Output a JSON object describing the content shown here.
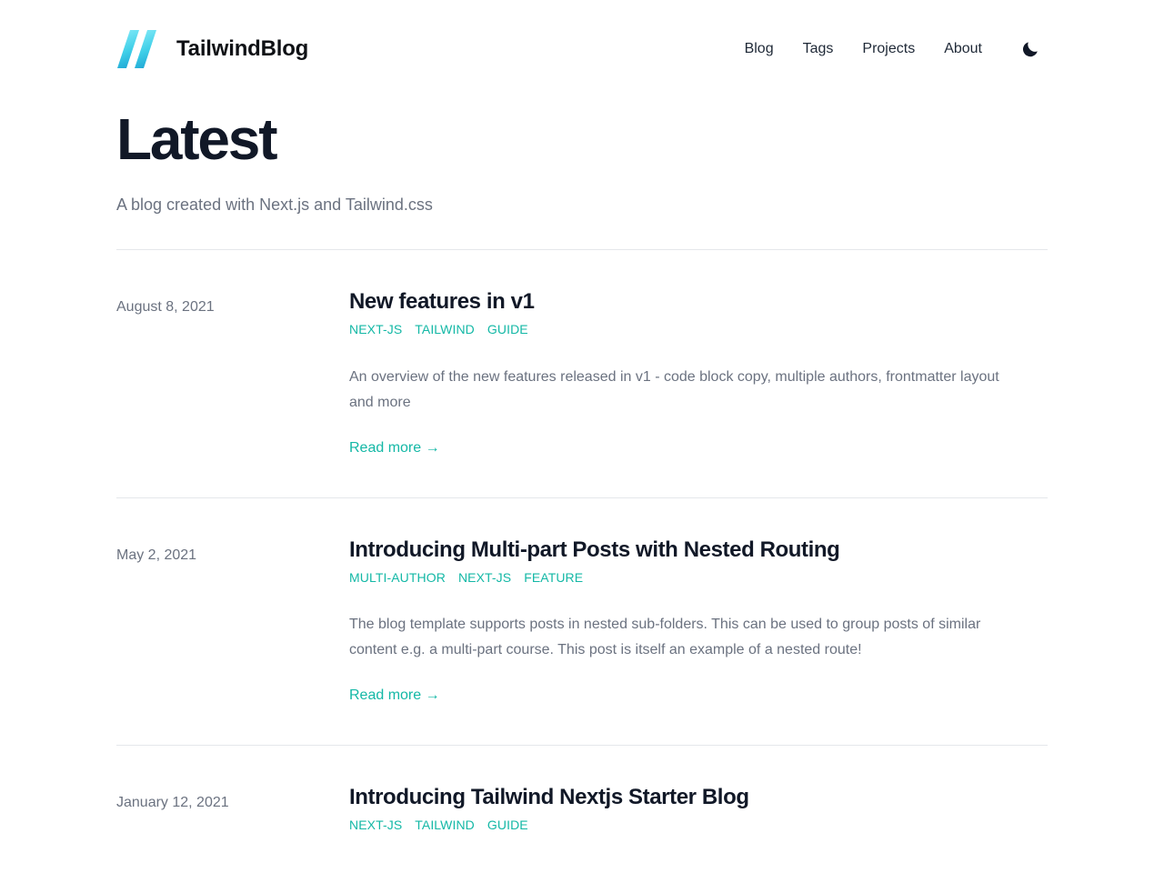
{
  "header": {
    "brand_name": "TailwindBlog",
    "logo_icon": "tailwind-slashes-logo",
    "nav": [
      {
        "label": "Blog"
      },
      {
        "label": "Tags"
      },
      {
        "label": "Projects"
      },
      {
        "label": "About"
      }
    ],
    "theme_toggle_icon": "moon-icon"
  },
  "hero": {
    "title": "Latest",
    "subtitle": "A blog created with Next.js and Tailwind.css"
  },
  "colors": {
    "accent": "#14b8a6",
    "logo_gradient_from": "#67e8f9",
    "logo_gradient_to": "#22a8d6",
    "text": "#111827",
    "muted": "#6b7280",
    "divider": "#e5e7eb"
  },
  "posts": [
    {
      "date": "August 8, 2021",
      "title": "New features in v1",
      "tags": [
        "NEXT-JS",
        "TAILWIND",
        "GUIDE"
      ],
      "excerpt": "An overview of the new features released in v1 - code block copy, multiple authors, frontmatter layout and more",
      "read_more": "Read more",
      "read_more_arrow": "→"
    },
    {
      "date": "May 2, 2021",
      "title": "Introducing Multi-part Posts with Nested Routing",
      "tags": [
        "MULTI-AUTHOR",
        "NEXT-JS",
        "FEATURE"
      ],
      "excerpt": "The blog template supports posts in nested sub-folders. This can be used to group posts of similar content e.g. a multi-part course. This post is itself an example of a nested route!",
      "read_more": "Read more",
      "read_more_arrow": "→"
    },
    {
      "date": "January 12, 2021",
      "title": "Introducing Tailwind Nextjs Starter Blog",
      "tags": [
        "NEXT-JS",
        "TAILWIND",
        "GUIDE"
      ],
      "excerpt": "",
      "read_more": "",
      "read_more_arrow": ""
    }
  ]
}
